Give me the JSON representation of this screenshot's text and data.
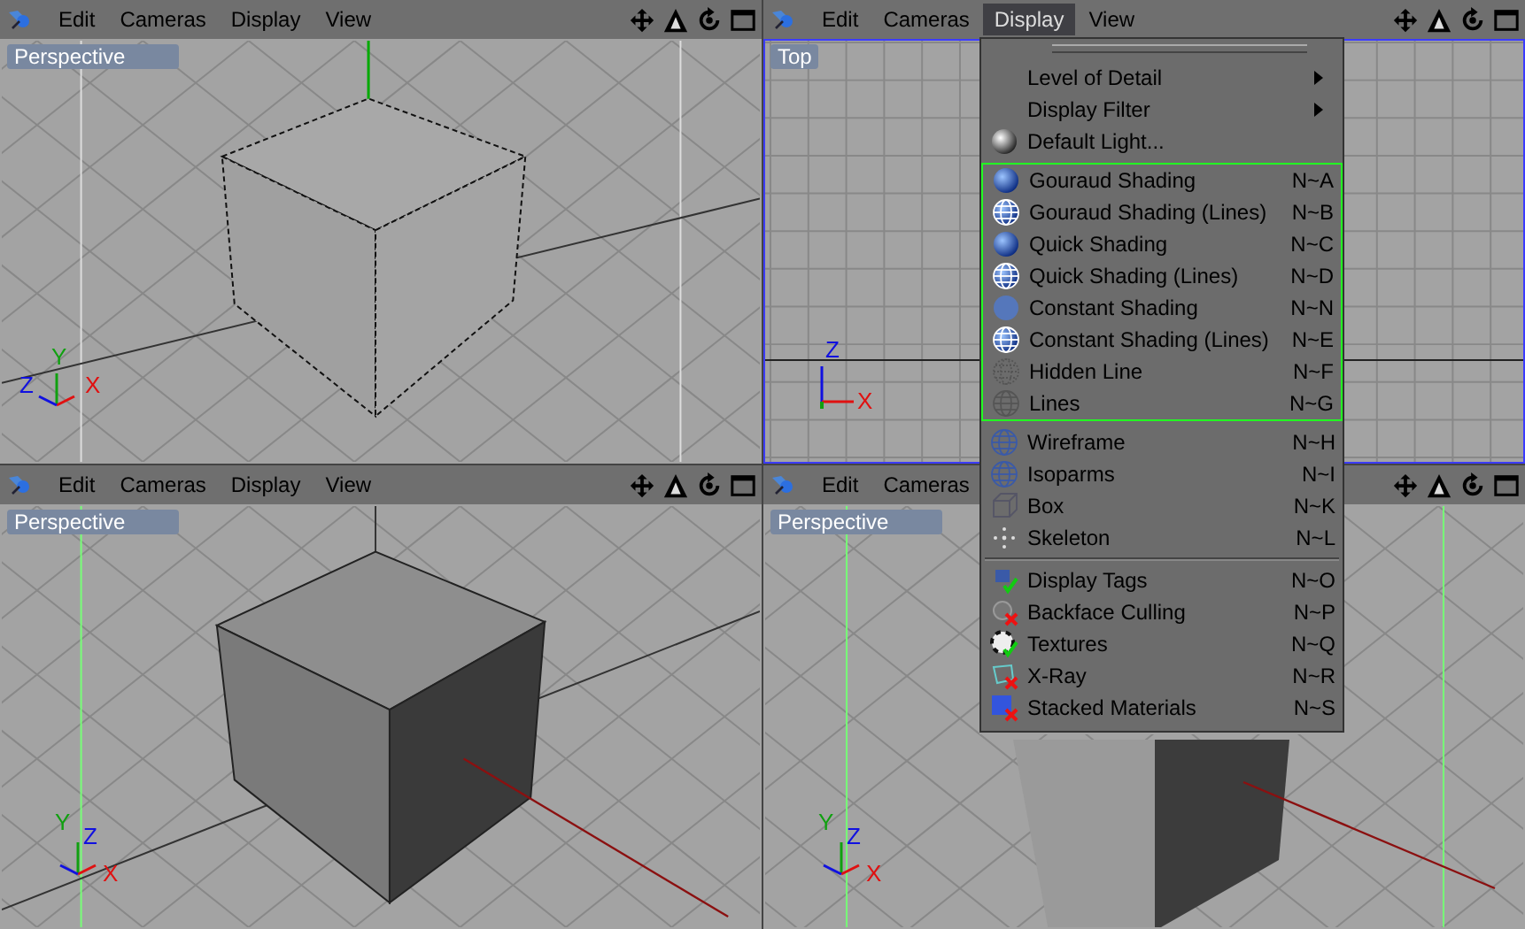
{
  "viewports": [
    {
      "title": "Perspective",
      "active": false,
      "menu": [
        {
          "label": "Edit",
          "selected": false
        },
        {
          "label": "Cameras",
          "selected": false
        },
        {
          "label": "Display",
          "selected": false
        },
        {
          "label": "View",
          "selected": false
        }
      ],
      "axes": [
        "Z",
        "Y",
        "X"
      ]
    },
    {
      "title": "Top",
      "active": true,
      "menu": [
        {
          "label": "Edit",
          "selected": false
        },
        {
          "label": "Cameras",
          "selected": false
        },
        {
          "label": "Display",
          "selected": true
        },
        {
          "label": "View",
          "selected": false
        }
      ],
      "axes": [
        "Z",
        "X"
      ]
    },
    {
      "title": "Perspective",
      "active": false,
      "menu": [
        {
          "label": "Edit",
          "selected": false
        },
        {
          "label": "Cameras",
          "selected": false
        },
        {
          "label": "Display",
          "selected": false
        },
        {
          "label": "View",
          "selected": false
        }
      ],
      "axes": [
        "Y",
        "Z",
        "X"
      ]
    },
    {
      "title": "Perspective",
      "active": false,
      "menu": [
        {
          "label": "Edit",
          "selected": false
        },
        {
          "label": "Cameras",
          "selected": false
        }
      ],
      "axes": [
        "Y",
        "Z",
        "X"
      ]
    }
  ],
  "display_menu": {
    "sections": [
      {
        "framed": false,
        "items": [
          {
            "kind": "submenu",
            "label": "Level of Detail"
          },
          {
            "kind": "submenu",
            "label": "Display Filter"
          },
          {
            "kind": "command",
            "label": "Default Light..."
          }
        ]
      },
      {
        "framed": true,
        "items": [
          {
            "kind": "command",
            "label": "Gouraud Shading",
            "shortcut": "N~A"
          },
          {
            "kind": "command",
            "label": "Gouraud Shading (Lines)",
            "shortcut": "N~B"
          },
          {
            "kind": "command",
            "label": "Quick Shading",
            "shortcut": "N~C"
          },
          {
            "kind": "command",
            "label": "Quick Shading (Lines)",
            "shortcut": "N~D"
          },
          {
            "kind": "command",
            "label": "Constant Shading",
            "shortcut": "N~N"
          },
          {
            "kind": "command",
            "label": "Constant Shading (Lines)",
            "shortcut": "N~E"
          },
          {
            "kind": "command",
            "label": "Hidden Line",
            "shortcut": "N~F"
          },
          {
            "kind": "command",
            "label": "Lines",
            "shortcut": "N~G"
          }
        ]
      },
      {
        "framed": false,
        "items": [
          {
            "kind": "command",
            "label": "Wireframe",
            "shortcut": "N~H"
          },
          {
            "kind": "command",
            "label": "Isoparms",
            "shortcut": "N~I"
          },
          {
            "kind": "command",
            "label": "Box",
            "shortcut": "N~K"
          },
          {
            "kind": "command",
            "label": "Skeleton",
            "shortcut": "N~L"
          }
        ]
      },
      {
        "framed": false,
        "items": [
          {
            "kind": "toggle",
            "label": "Display Tags",
            "shortcut": "N~O",
            "checked": true
          },
          {
            "kind": "toggle",
            "label": "Backface Culling",
            "shortcut": "N~P",
            "checked": false
          },
          {
            "kind": "toggle",
            "label": "Textures",
            "shortcut": "N~Q",
            "checked": true
          },
          {
            "kind": "toggle",
            "label": "X-Ray",
            "shortcut": "N~R",
            "checked": false
          },
          {
            "kind": "toggle",
            "label": "Stacked Materials",
            "shortcut": "N~S",
            "checked": false
          }
        ]
      }
    ]
  }
}
